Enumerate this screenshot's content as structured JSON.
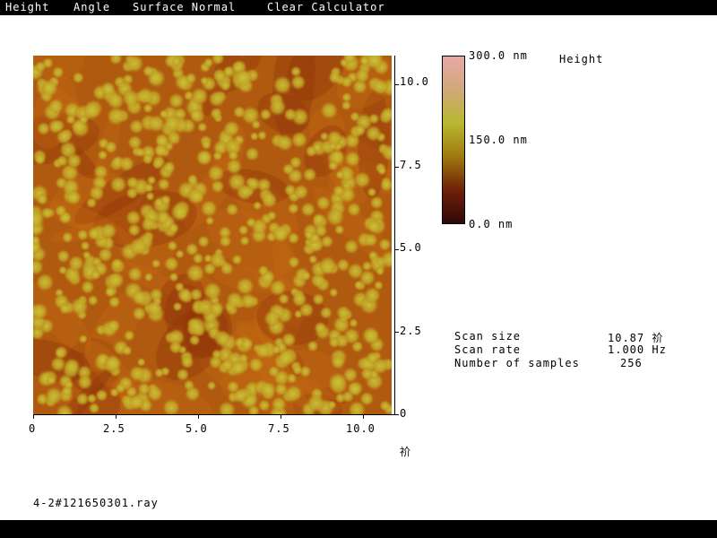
{
  "menu": [
    "Height",
    "Angle",
    "Surface Normal",
    "Clear Calculator"
  ],
  "image": {
    "y_ticks": [
      "10.0",
      "7.5",
      "5.0",
      "2.5",
      "0"
    ],
    "x_ticks": [
      "0",
      "2.5",
      "5.0",
      "7.5",
      "10.0"
    ],
    "x_unit": "祄",
    "range_um": 10.87
  },
  "colorbar": {
    "title": "Height",
    "max_label": "300.0 nm",
    "mid_label": "150.0 nm",
    "min_label": "0.0 nm",
    "colors": [
      "#e8a8a8",
      "#d0a878",
      "#b8b830",
      "#a07810",
      "#702008",
      "#300808"
    ]
  },
  "scan_info": [
    {
      "label": "Scan size",
      "value": "10.87 祄"
    },
    {
      "label": "Scan rate",
      "value": "1.000 Hz"
    },
    {
      "label": "Number of samples",
      "value": "256"
    }
  ],
  "filename": "4-2#121650301.ray"
}
